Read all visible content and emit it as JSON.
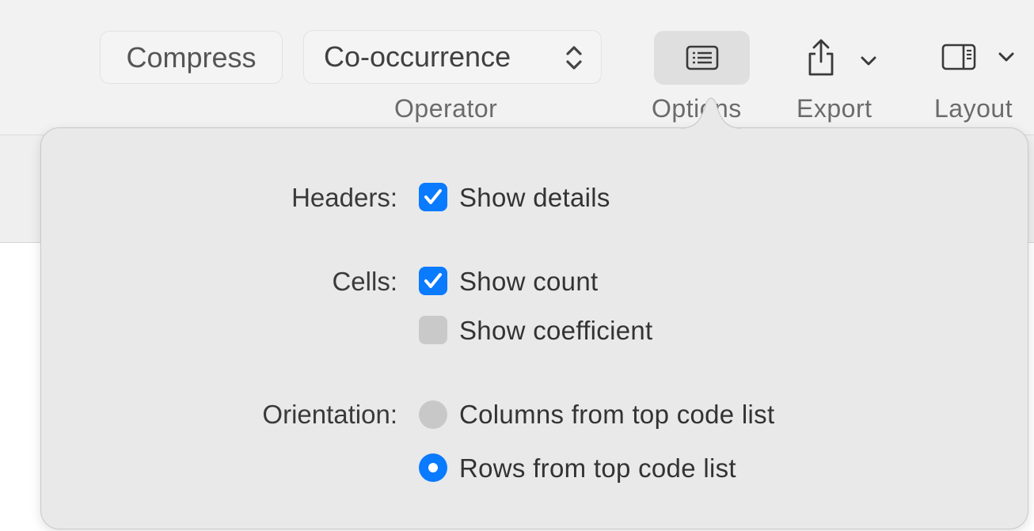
{
  "toolbar": {
    "compress_label": "Compress",
    "operator_value": "Co-occurrence",
    "operator_label": "Operator",
    "options_label": "Options",
    "export_label": "Export",
    "layout_label": "Layout",
    "icons": [
      "updown-chevron-icon",
      "list-icon",
      "share-icon",
      "chevron-down-icon",
      "sidebar-layout-icon"
    ]
  },
  "popover": {
    "headers": {
      "label": "Headers:",
      "show_details": {
        "label": "Show details",
        "checked": true
      }
    },
    "cells": {
      "label": "Cells:",
      "show_count": {
        "label": "Show count",
        "checked": true
      },
      "show_coefficient": {
        "label": "Show coefficient",
        "checked": false
      }
    },
    "orientation": {
      "label": "Orientation:",
      "options": [
        {
          "label": "Columns from top code list",
          "selected": false
        },
        {
          "label": "Rows from top code list",
          "selected": true
        }
      ]
    }
  },
  "colors": {
    "accent": "#0a7aff",
    "popover_bg": "#e9e9e9",
    "toolbar_bg": "#f2f2f2"
  }
}
